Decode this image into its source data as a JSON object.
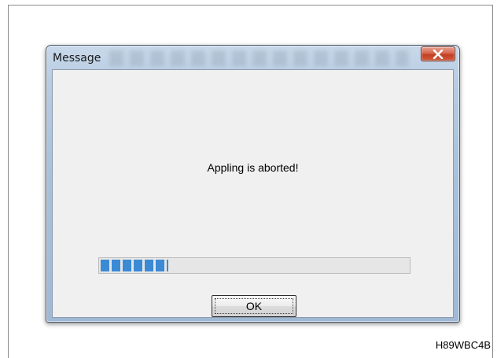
{
  "dialog": {
    "title": "Message",
    "message": "Appling is aborted!",
    "ok_label": "OK",
    "progress": 0.22,
    "close_icon": "close-x-icon"
  },
  "figure": {
    "caption": "H89WBC4B"
  },
  "colors": {
    "progress_fill": "#3a8ad6",
    "close_button": "#c8472c",
    "window_frame": "#aac2dc",
    "client_bg": "#f0f0f0"
  }
}
